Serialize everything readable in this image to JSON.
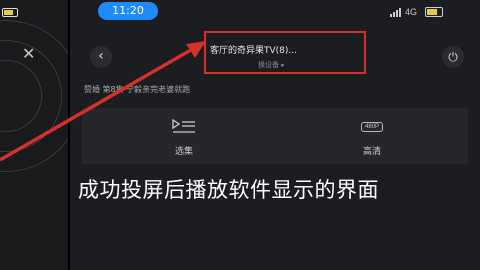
{
  "status": {
    "time": "11:20",
    "network": "4G"
  },
  "header": {
    "title": "客厅的奇异果TV(8)...",
    "subtitle": "换设备 ▸"
  },
  "episode_info": "赞婚 第8集  宁毅亲完老婆就跑",
  "controls": {
    "select_label": "选集",
    "quality_label": "高清",
    "quality_badge": "480P"
  },
  "caption": "成功投屏后播放软件显示的界面",
  "colors": {
    "highlight": "#d3312a",
    "time_pill": "#1e8bff"
  }
}
